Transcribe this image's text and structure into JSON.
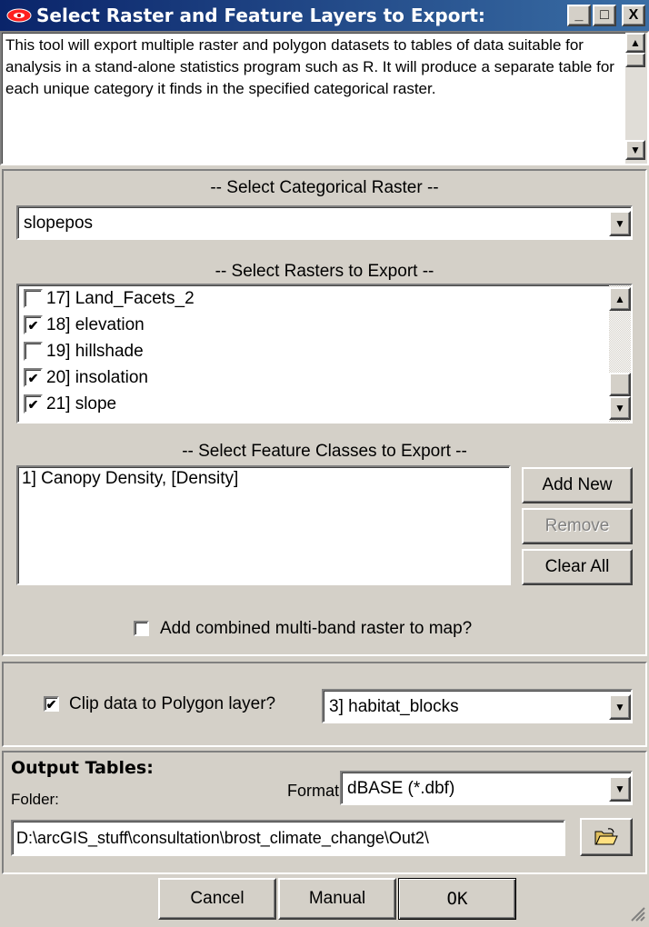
{
  "window": {
    "title": "Select Raster and Feature Layers to Export:",
    "minimize": "_",
    "maximize": "□",
    "close": "X"
  },
  "description": "This tool will export multiple raster and polygon datasets to tables of data suitable for analysis in a stand-alone statistics program such as R.  It will produce a separate table for each unique category it finds in the specified categorical raster.",
  "categorical": {
    "heading": "-- Select Categorical Raster --",
    "value": "slopepos"
  },
  "rasters": {
    "heading": "-- Select Rasters to Export --",
    "items": [
      {
        "label": "17] Land_Facets_2",
        "checked": false
      },
      {
        "label": "18] elevation",
        "checked": true
      },
      {
        "label": "19] hillshade",
        "checked": false
      },
      {
        "label": "20] insolation",
        "checked": true
      },
      {
        "label": "21] slope",
        "checked": true
      }
    ]
  },
  "features": {
    "heading": "-- Select Feature Classes to Export --",
    "items": [
      "1] Canopy Density, [Density]"
    ],
    "add_new": "Add New",
    "remove": "Remove",
    "clear_all": "Clear All"
  },
  "add_combined_label": "Add combined multi-band raster to map?",
  "clip": {
    "label": "Clip data to Polygon layer?",
    "checked": true,
    "layer": "3] habitat_blocks"
  },
  "output": {
    "heading": "Output Tables:",
    "format_label": "Format:",
    "format_value": "dBASE (*.dbf)",
    "folder_label": "Folder:",
    "folder_value": "D:\\arcGIS_stuff\\consultation\\brost_climate_change\\Out2\\"
  },
  "buttons": {
    "cancel": "Cancel",
    "manual": "Manual",
    "ok": "OK"
  },
  "icons": {
    "app": "eye-icon",
    "dropdown": "chevron-down-icon",
    "folder": "folder-open-icon"
  },
  "check_mark": "✔",
  "arrow_down": "▼",
  "arrow_up": "▲"
}
